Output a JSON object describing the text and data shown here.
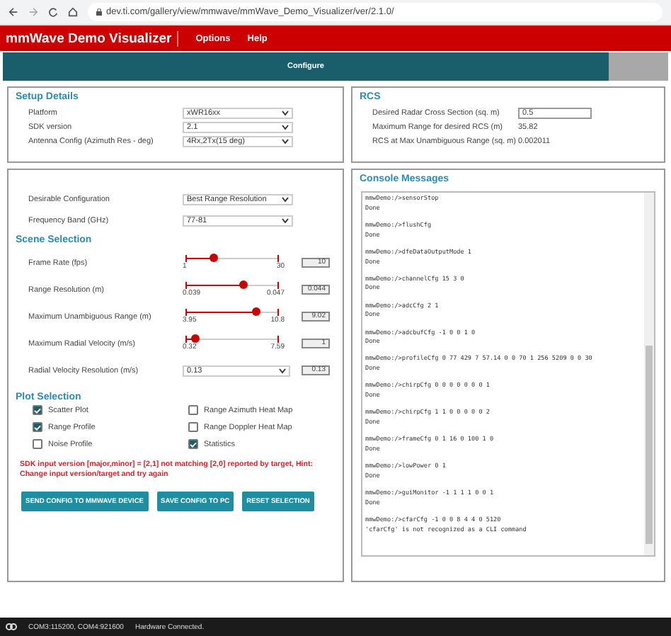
{
  "browser": {
    "url": "dev.ti.com/gallery/view/mmwave/mmWave_Demo_Visualizer/ver/2.1.0/"
  },
  "header": {
    "title": "mmWave Demo Visualizer",
    "menu": [
      "Options",
      "Help"
    ]
  },
  "tabs": [
    {
      "label": "Configure",
      "selected": true
    },
    {
      "selected": false
    }
  ],
  "setup": {
    "title": "Setup Details",
    "fields": [
      {
        "label": "Platform",
        "value": "xWR16xx"
      },
      {
        "label": "SDK version",
        "value": "2.1"
      },
      {
        "label": "Antenna Config (Azimuth Res - deg)",
        "value": "4Rx,2Tx(15 deg)"
      }
    ]
  },
  "config": {
    "fields": [
      {
        "label": "Desirable Configuration",
        "value": "Best Range Resolution"
      },
      {
        "label": "Frequency Band (GHz)",
        "value": "77-81"
      }
    ],
    "scene_title": "Scene Selection",
    "scene": [
      {
        "kind": "slider",
        "label": "Frame Rate (fps)",
        "min": "1",
        "max": "30",
        "level": 0.3,
        "value": "10"
      },
      {
        "kind": "slider",
        "label": "Range Resolution (m)",
        "min": "0.039",
        "max": "0.047",
        "level": 0.62,
        "value": "0.044"
      },
      {
        "kind": "slider",
        "label": "Maximum Unambiguous Range (m)",
        "min": "3.95",
        "max": "10.8",
        "level": 0.76,
        "value": "9.02"
      },
      {
        "kind": "slider",
        "label": "Maximum Radial Velocity (m/s)",
        "min": "0.32",
        "max": "7.59",
        "level": 0.1,
        "value": "1"
      },
      {
        "kind": "select",
        "label": "Radial Velocity Resolution (m/s)",
        "select": "0.13",
        "value": "0.13"
      }
    ],
    "plot_title": "Plot Selection",
    "plots": [
      {
        "label": "Scatter Plot",
        "checked": true
      },
      {
        "label": "Range Azimuth Heat Map",
        "checked": false
      },
      {
        "label": "Range Profile",
        "checked": true
      },
      {
        "label": "Range Doppler Heat Map",
        "checked": false
      },
      {
        "label": "Noise Profile",
        "checked": false
      },
      {
        "label": "Statistics",
        "checked": true
      }
    ],
    "error": "SDK input version [major,minor] = [2,1] not matching [2,0] reported by target, Hint: Change input version/target and try again",
    "buttons": [
      "SEND CONFIG TO MMWAVE DEVICE",
      "SAVE CONFIG TO PC",
      "RESET SELECTION"
    ]
  },
  "rcs": {
    "title": "RCS",
    "rows": [
      {
        "kind": "input",
        "label": "Desired Radar Cross Section (sq. m)",
        "value": "0.5"
      },
      {
        "kind": "text",
        "label": "Maximum Range for desired RCS (m)",
        "value": "35.82"
      },
      {
        "kind": "text",
        "label": "RCS at Max Unambiguous Range (sq. m)",
        "value": "0.002011"
      }
    ]
  },
  "console": {
    "title": "Console Messages",
    "entries": [
      {
        "command": "mmwDemo:/>sensorStop",
        "response": "Done"
      },
      {
        "command": "mmwDemo:/>flushCfg",
        "response": "Done"
      },
      {
        "command": "mmwDemo:/>dfeDataOutputMode 1",
        "response": "Done"
      },
      {
        "command": "mmwDemo:/>channelCfg 15 3 0",
        "response": "Done"
      },
      {
        "command": "mmwDemo:/>adcCfg 2 1",
        "response": "Done"
      },
      {
        "command": "mmwDemo:/>adcbufCfg -1 0 0 1 0",
        "response": "Done"
      },
      {
        "command": "mmwDemo:/>profileCfg 0 77 429 7 57.14 0 0 70 1 256 5209 0 0 30",
        "response": "Done"
      },
      {
        "command": "mmwDemo:/>chirpCfg 0 0 0 0 0 0 0 1",
        "response": "Done"
      },
      {
        "command": "mmwDemo:/>chirpCfg 1 1 0 0 0 0 0 2",
        "response": "Done"
      },
      {
        "command": "mmwDemo:/>frameCfg 0 1 16 0 100 1 0",
        "response": "Done"
      },
      {
        "command": "mmwDemo:/>lowPower 0 1",
        "response": "Done"
      },
      {
        "command": "mmwDemo:/>guiMonitor -1 1 1 1 0 0 1",
        "response": "Done"
      },
      {
        "command": "mmwDemo:/>cfarCfg -1 0 0 8 4 4 0 5120",
        "response": "'cfarCfg' is not recognized as a CLI command"
      }
    ]
  },
  "status_bar": {
    "ports": "COM3:115200, COM4:921600",
    "status": "Hardware Connected."
  }
}
